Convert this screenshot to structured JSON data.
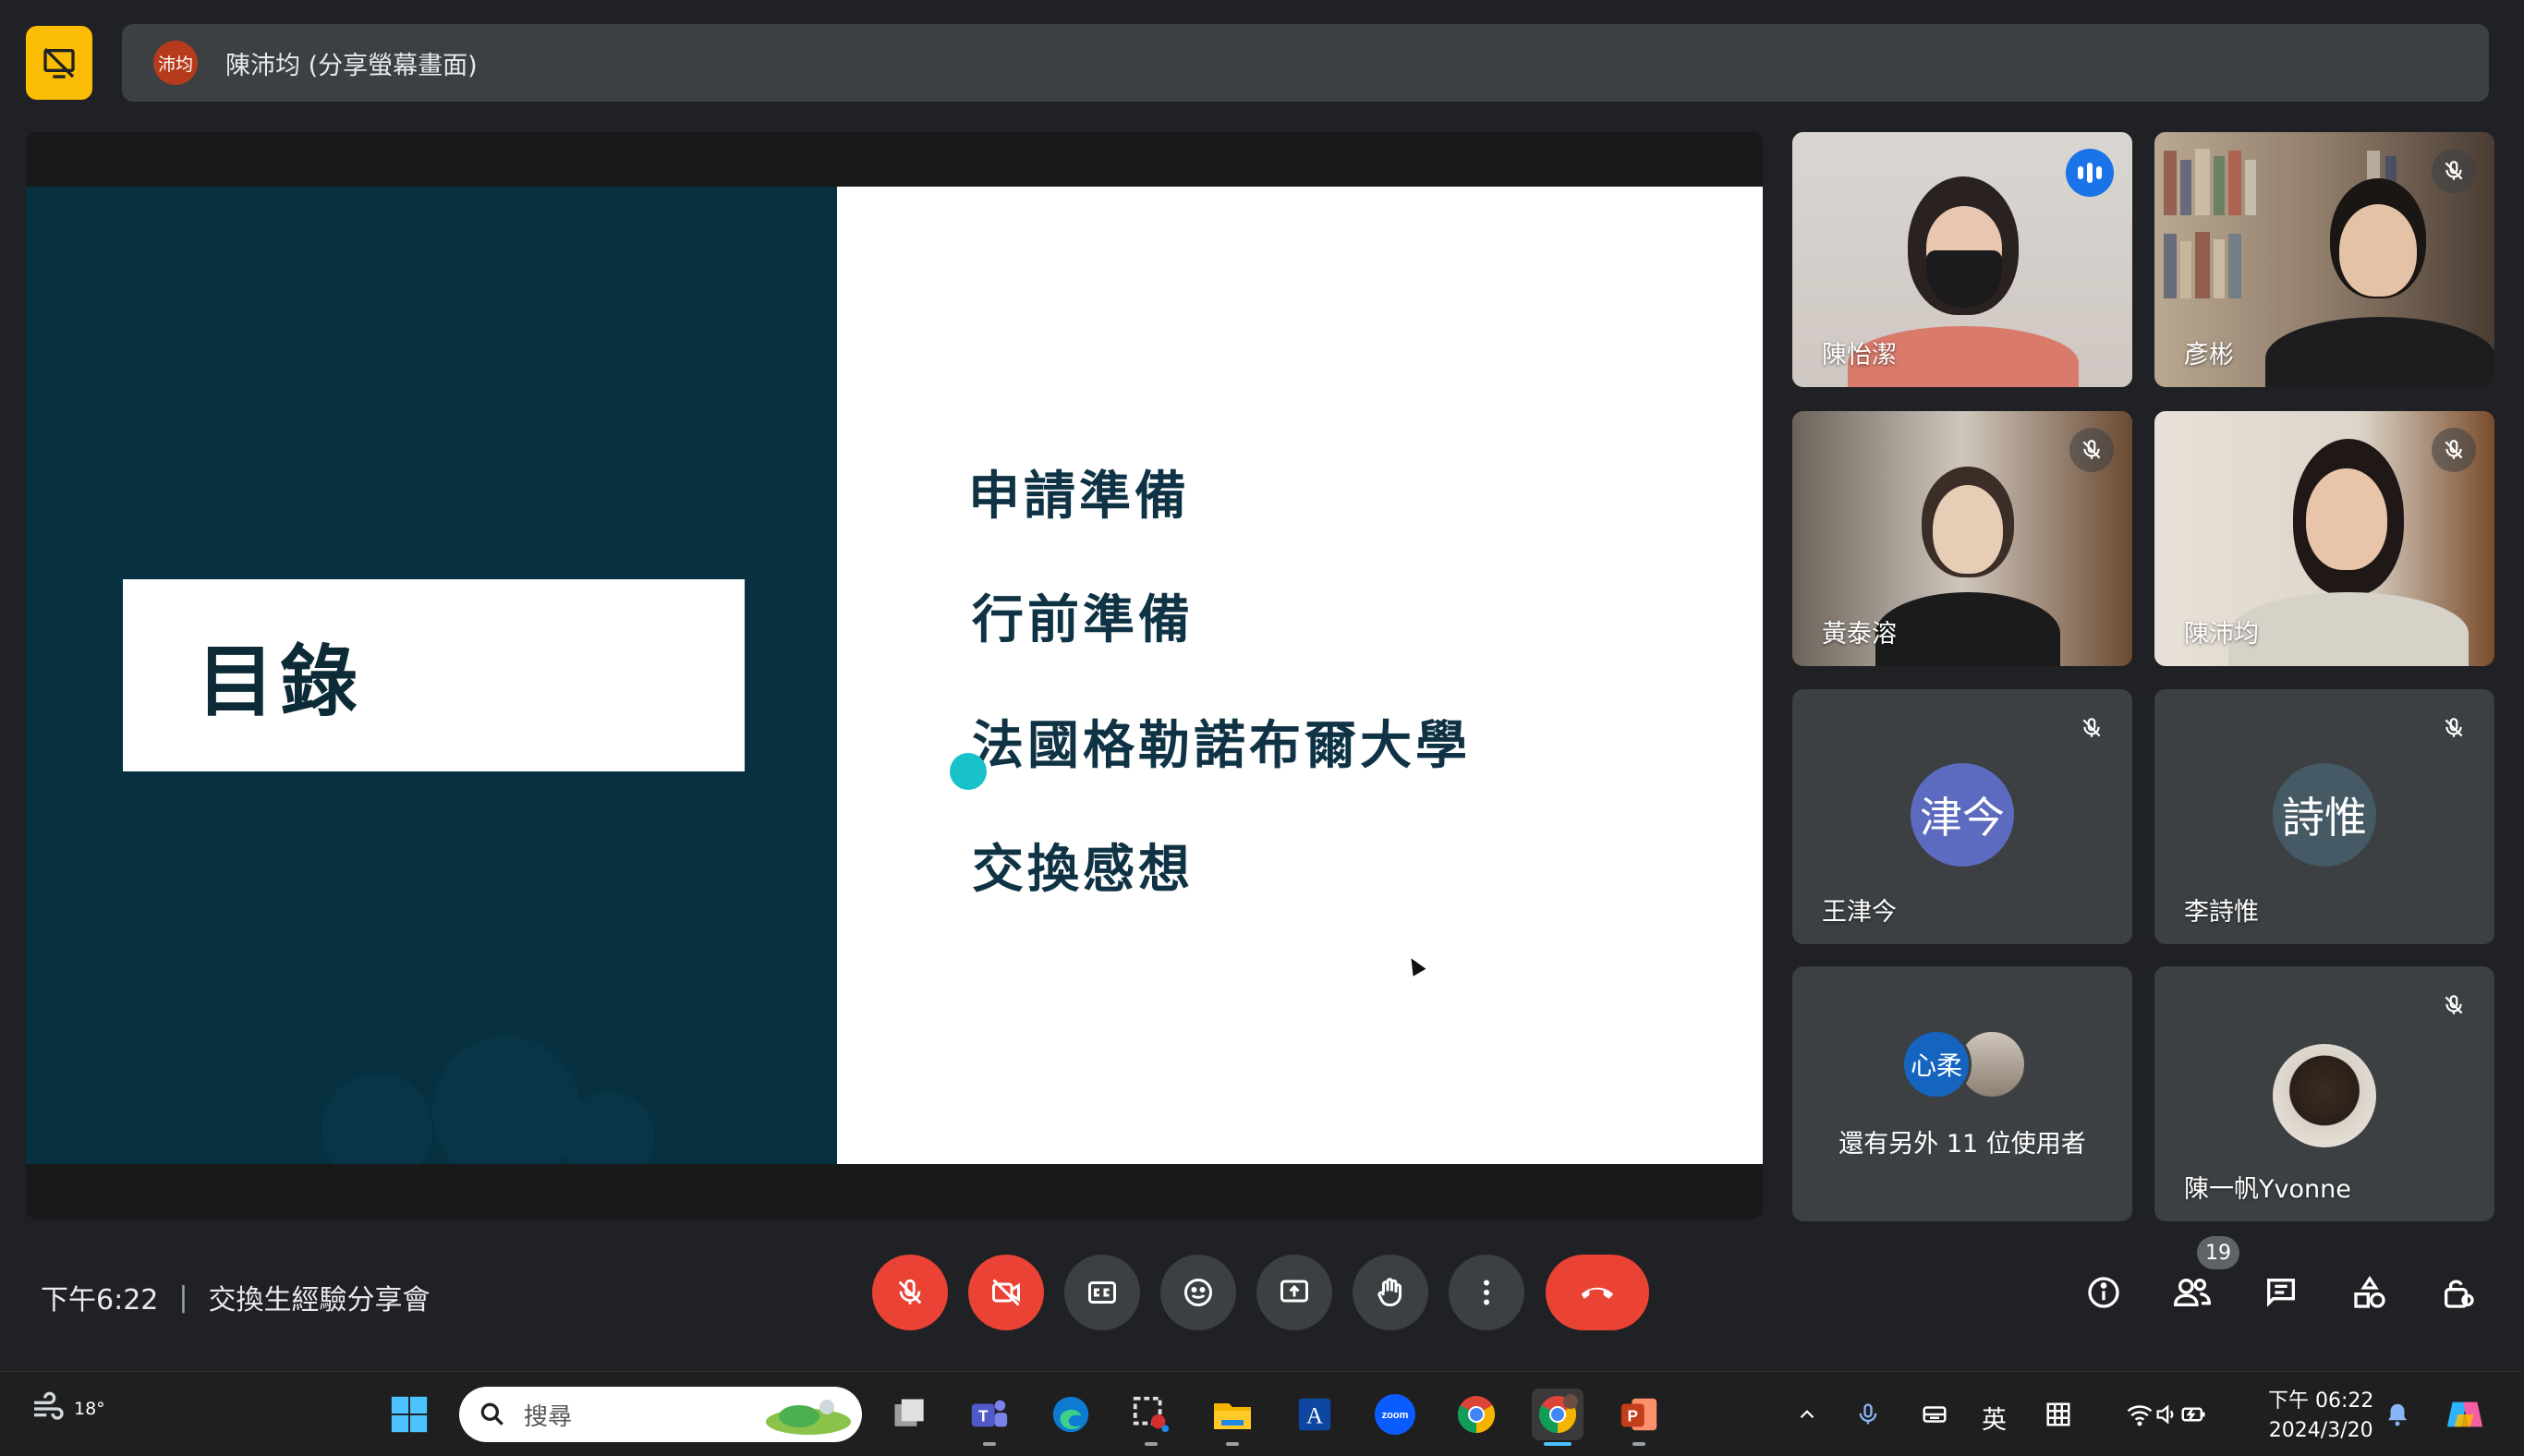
{
  "top_bar": {
    "presenter_initials": "沛均",
    "share_label": "陳沛均 (分享螢幕畫面)"
  },
  "slide": {
    "title": "目錄",
    "agenda": [
      "申請準備",
      "行前準備",
      "法國格勒諾布爾大學",
      "交換感想"
    ]
  },
  "participants": [
    {
      "name": "陳怡潔",
      "state": "speaking",
      "avatar": ""
    },
    {
      "name": "彥彬",
      "state": "muted",
      "avatar": ""
    },
    {
      "name": "黃泰溶",
      "state": "muted",
      "avatar": ""
    },
    {
      "name": "陳沛均",
      "state": "muted",
      "avatar": ""
    },
    {
      "name": "王津今",
      "state": "muted",
      "avatar": "津今",
      "avatar_color": "#5c6bc0"
    },
    {
      "name": "李詩惟",
      "state": "muted",
      "avatar": "詩惟",
      "avatar_color": "#455a64"
    },
    {
      "name": "還有另外 11 位使用者",
      "state": "others",
      "avatar": "心柔",
      "avatar_color": "#1565c0"
    },
    {
      "name": "陳一帆Yvonne",
      "state": "muted",
      "avatar": ""
    }
  ],
  "meeting": {
    "time": "下午6:22",
    "title": "交換生經驗分享會",
    "participant_count": "19"
  },
  "controls": [
    "mic-off-icon",
    "camera-off-icon",
    "captions-icon",
    "emoji-icon",
    "present-icon",
    "raise-hand-icon",
    "more-options-icon",
    "end-call-icon"
  ],
  "right_controls": [
    "info-icon",
    "people-icon",
    "chat-icon",
    "activities-icon",
    "host-controls-icon"
  ],
  "taskbar": {
    "weather_temp": "18°",
    "search_placeholder": "搜尋",
    "ime_label": "英",
    "clock_time": "下午 06:22",
    "clock_date": "2024/3/20"
  },
  "colors": {
    "slide_dark": "#073040",
    "accent_blue": "#8ab4f8",
    "red": "#ea4335",
    "present_yellow": "#fbbc04"
  }
}
